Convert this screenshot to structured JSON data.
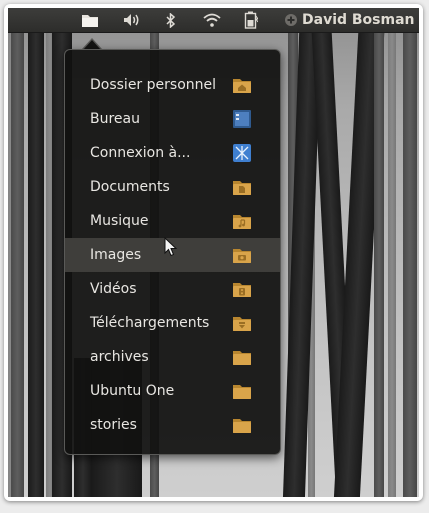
{
  "topbar": {
    "icons": [
      "folder-icon",
      "volume-icon",
      "bluetooth-icon",
      "wifi-icon",
      "battery-icon",
      "user-status-icon"
    ],
    "user_name": "David Bosman"
  },
  "places_menu": {
    "items": [
      {
        "label": "Dossier personnel",
        "icon": "home-folder-icon"
      },
      {
        "label": "Bureau",
        "icon": "desktop-icon"
      },
      {
        "label": "Connexion à...",
        "icon": "network-connect-icon"
      },
      {
        "label": "Documents",
        "icon": "documents-folder-icon"
      },
      {
        "label": "Musique",
        "icon": "music-folder-icon"
      },
      {
        "label": "Images",
        "icon": "pictures-folder-icon"
      },
      {
        "label": "Vidéos",
        "icon": "videos-folder-icon"
      },
      {
        "label": "Téléchargements",
        "icon": "downloads-folder-icon"
      },
      {
        "label": "archives",
        "icon": "folder-icon"
      },
      {
        "label": "Ubuntu One",
        "icon": "folder-icon"
      },
      {
        "label": "stories",
        "icon": "folder-icon"
      }
    ],
    "hovered_item": "Images"
  },
  "colors": {
    "panel": "#2d2d2b",
    "menu_bg": "#111110",
    "menu_hover": "#3f3e3b",
    "folder": "#d9a44a",
    "text": "#e8e6e2"
  }
}
